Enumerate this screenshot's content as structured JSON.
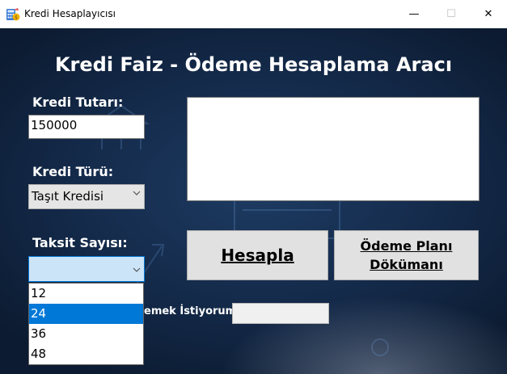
{
  "window": {
    "title": "Kredi Hesaplayıcısı",
    "minimize_glyph": "—",
    "maximize_glyph": "☐",
    "close_glyph": "✕"
  },
  "main": {
    "heading": "Kredi Faiz - Ödeme Hesaplama Aracı",
    "amount": {
      "label": "Kredi Tutarı:",
      "value": "150000"
    },
    "type": {
      "label": "Kredi Türü:",
      "selected": "Taşıt Kredisi"
    },
    "installments": {
      "label": "Taksit Sayısı:",
      "selected": "",
      "options": [
        "12",
        "24",
        "36",
        "48"
      ],
      "highlighted_index": 1
    },
    "calculate_button": "Hesapla",
    "plan_button": [
      "Ödeme Planı",
      "Dökümanı"
    ],
    "checkbox_text_visible": "emek İstiyorum",
    "extra_input_value": ""
  },
  "colors": {
    "background_dark": "#0c1b31",
    "background_mid": "#1d3b62",
    "selection_blue": "#0078d7",
    "button_gray": "#e1e1e1"
  }
}
